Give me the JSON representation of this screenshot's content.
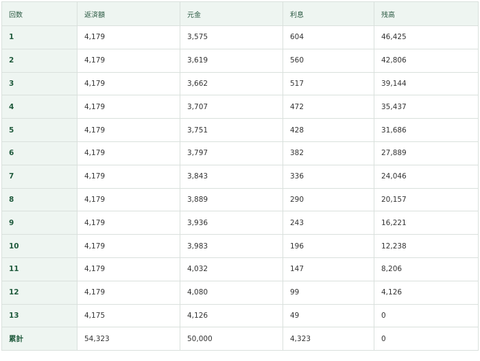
{
  "table": {
    "headers": [
      "回数",
      "返済額",
      "元金",
      "利息",
      "残高"
    ],
    "rows": [
      {
        "label": "1",
        "cells": [
          "4,179",
          "3,575",
          "604",
          "46,425"
        ]
      },
      {
        "label": "2",
        "cells": [
          "4,179",
          "3,619",
          "560",
          "42,806"
        ]
      },
      {
        "label": "3",
        "cells": [
          "4,179",
          "3,662",
          "517",
          "39,144"
        ]
      },
      {
        "label": "4",
        "cells": [
          "4,179",
          "3,707",
          "472",
          "35,437"
        ]
      },
      {
        "label": "5",
        "cells": [
          "4,179",
          "3,751",
          "428",
          "31,686"
        ]
      },
      {
        "label": "6",
        "cells": [
          "4,179",
          "3,797",
          "382",
          "27,889"
        ]
      },
      {
        "label": "7",
        "cells": [
          "4,179",
          "3,843",
          "336",
          "24,046"
        ]
      },
      {
        "label": "8",
        "cells": [
          "4,179",
          "3,889",
          "290",
          "20,157"
        ]
      },
      {
        "label": "9",
        "cells": [
          "4,179",
          "3,936",
          "243",
          "16,221"
        ]
      },
      {
        "label": "10",
        "cells": [
          "4,179",
          "3,983",
          "196",
          "12,238"
        ]
      },
      {
        "label": "11",
        "cells": [
          "4,179",
          "4,032",
          "147",
          "8,206"
        ]
      },
      {
        "label": "12",
        "cells": [
          "4,179",
          "4,080",
          "99",
          "4,126"
        ]
      },
      {
        "label": "13",
        "cells": [
          "4,175",
          "4,126",
          "49",
          "0"
        ]
      },
      {
        "label": "累計",
        "cells": [
          "54,323",
          "50,000",
          "4,323",
          "0"
        ]
      }
    ]
  },
  "colors": {
    "header_bg": "#eef5f1",
    "header_text": "#2b5a43",
    "row_label_text": "#1f5a3c",
    "border": "#d9e0dc"
  }
}
